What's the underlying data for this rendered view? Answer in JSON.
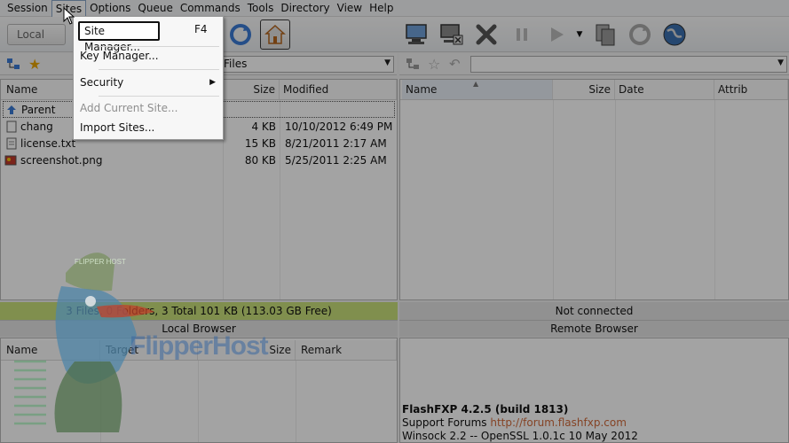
{
  "menu": [
    "Session",
    "Sites",
    "Options",
    "Queue",
    "Commands",
    "Tools",
    "Directory",
    "View",
    "Help"
  ],
  "toolbar": {
    "local_label": "Local"
  },
  "sites_menu": {
    "items": [
      {
        "label": "Site Manager...",
        "shortcut": "F4"
      },
      {
        "label": "Key Manager..."
      },
      {
        "label": "Security",
        "has_submenu": true
      },
      {
        "label": "Add Current Site...",
        "disabled": true
      },
      {
        "label": "Import Sites..."
      }
    ]
  },
  "local": {
    "path": "Files",
    "columns": [
      "Name",
      "Size",
      "Modified"
    ],
    "files": [
      {
        "name": "Parent",
        "size": "",
        "modified": ""
      },
      {
        "name": "chang",
        "size": "4 KB",
        "modified": "10/10/2012 6:49 PM"
      },
      {
        "name": "license.txt",
        "size": "15 KB",
        "modified": "8/21/2011 2:17 AM"
      },
      {
        "name": "screenshot.png",
        "size": "80 KB",
        "modified": "5/25/2011 2:25 AM"
      }
    ],
    "status": "3 Files, 0 Folders, 3 Total 101 KB (113.03 GB Free)",
    "browser_label": "Local Browser"
  },
  "remote": {
    "columns": [
      "Name",
      "Size",
      "Date",
      "Attrib"
    ],
    "status": "Not connected",
    "browser_label": "Remote Browser"
  },
  "queue": {
    "columns": [
      "Name",
      "Target",
      "Size",
      "Remark"
    ]
  },
  "log": {
    "title": "FlashFXP 4.2.5 (build 1813)",
    "support_prefix": "Support Forums ",
    "support_link": "http://forum.flashfxp.com",
    "winsock": "Winsock 2.2 -- OpenSSL 1.0.1c 10 May 2012"
  },
  "watermark": {
    "badge": "FLIPPER HOST",
    "text": "FlipperHost"
  },
  "colors": {
    "status_green": "#c9e07a",
    "status_gray": "#e3e3e3",
    "link": "#d06a3a"
  }
}
